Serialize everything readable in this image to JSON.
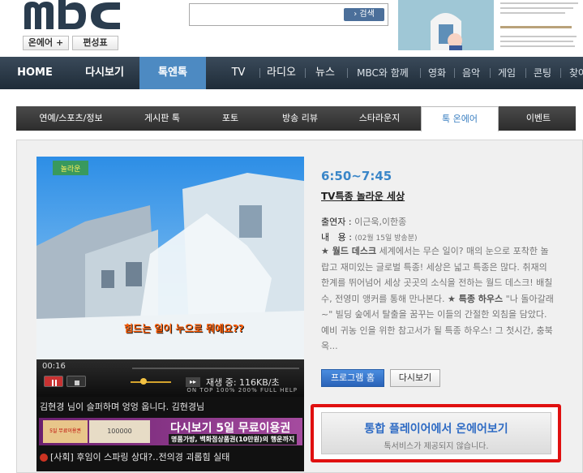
{
  "header": {
    "logo": "MBC",
    "onair_label": "온에어 +",
    "schedule_label": "편성표",
    "search_placeholder": "",
    "search_button": "› 검색"
  },
  "gnb": {
    "items": [
      "HOME",
      "다시보기",
      "톡엔톡",
      "TV",
      "라디오",
      "뉴스",
      "MBC와 함께",
      "영화",
      "음악",
      "게임",
      "콘팅",
      "찾아"
    ]
  },
  "subnav": {
    "items": [
      "연예/스포츠/정보",
      "게시판 톡",
      "포토",
      "방송 리뷰",
      "스타라운지",
      "톡 온에어",
      "이벤트"
    ],
    "active": "톡 온에어"
  },
  "player": {
    "caption": "힘드는 일이 누으로 뭐예요??",
    "time": "00:16",
    "speed_icon": "▸▸",
    "speed_text": "재생 중: 116KB/초",
    "footer_label": "ON TOP 100% 200% FULL HELP",
    "chat_text": "김현경 님이 슬퍼하며 엉엉 웁니다. 김현경님",
    "ad_card": "5일 무료이용권",
    "ad_note": "100000",
    "ad_title": "다시보기 5일 무료이용권",
    "ad_sub": "명품가방, 백화점상품권(10만원)의 행운까지",
    "news_text": "[사회] 후임이 스파링 상대?‥전의경 괴롭힘 실태"
  },
  "info": {
    "time": "6:50~7:45",
    "program": "TV특종 놀라운 세상",
    "cast_label": "출연자",
    "cast_value": "이근욱,이한종",
    "content_label": "내   용",
    "content_value": "(02월 15일 방송분)",
    "hl1": "★ 월드 데스크",
    "desc1": " 세계에서는 무슨 일이? 매의 눈으로 포착한 놀랍고 재미있는 글로벌 특종! 세상은 넓고 특종은 많다. 취재의 한계를 뛰어넘어 세상 곳곳의 소식을 전하는 월드 데스크! 배칠수, 전영미 앵커를 통해 만나본다. ",
    "hl2": "★ 특종 하우스",
    "desc2": " \"나 돌아갈래~\" 빌딩 숲에서 탈출을 꿈꾸는 이들의 간절한 외침을 담았다. 예비 귀농 인을 위한 참고서가 될 특종 하우스! 그 첫시간, 충북 옥...",
    "btn_program": "프로그램 홈",
    "btn_replay": "다시보기",
    "onair_title": "통합 플레이어에서 온에어보기",
    "onair_sub": "톡서비스가 제공되지 않습니다."
  }
}
